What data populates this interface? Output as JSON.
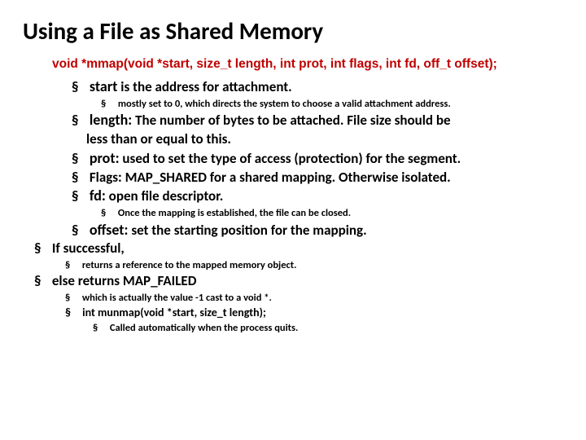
{
  "title": "Using a File as Shared Memory",
  "signature": "void *mmap(void *start, size_t length, int prot, int flags, int fd, off_t offset);",
  "params": {
    "start": {
      "kw": "start",
      "desc": " is the address for attachment.",
      "sub": "mostly set to 0, which directs the system to choose a valid attachment address."
    },
    "length": {
      "kw": "length:",
      "desc_line1": " The number of bytes to be attached. File size should be",
      "desc_line2": "less than or equal to this."
    },
    "prot": {
      "kw": "prot:",
      "desc": " used to set the type of access (protection) for the segment."
    },
    "flags": {
      "kw": "Flags:",
      "desc": " MAP_SHARED for a shared mapping. Otherwise isolated."
    },
    "fd": {
      "kw": "fd:",
      "desc": " open file descriptor.",
      "sub": "Once the mapping is established, the file can be closed."
    },
    "offset": {
      "kw": "offset:",
      "desc": " set the starting position for the mapping."
    }
  },
  "ret": {
    "ok": "If successful,",
    "ok_sub": "returns a reference to the mapped memory object.",
    "fail": "else returns MAP_FAILED",
    "fail_sub": "which is actually the value -1 cast to a void *.",
    "munmap": "int munmap(void *start, size_t length);",
    "munmap_sub": "Called automatically when the process quits."
  }
}
